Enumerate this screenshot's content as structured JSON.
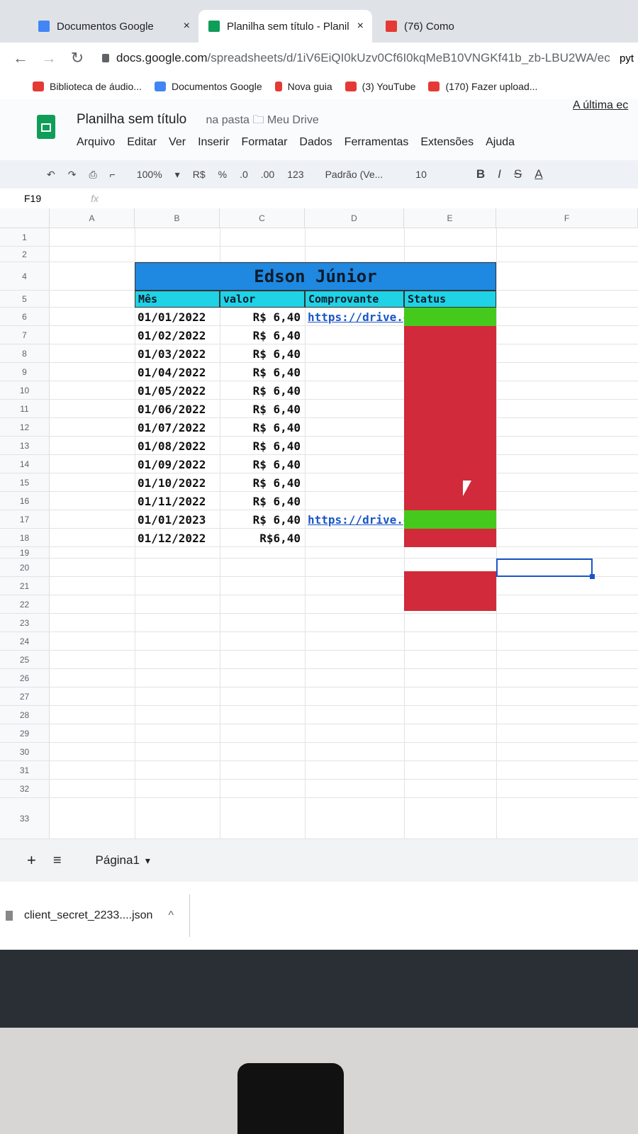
{
  "tabs": [
    {
      "title": "Documentos Google",
      "close": "×"
    },
    {
      "title": "Planilha sem título - Planil",
      "close": "×"
    },
    {
      "title": "(76) Como",
      "close": ""
    }
  ],
  "address": {
    "domain": "docs.google.com",
    "path": "/spreadsheets/d/1iV6EiQI0kUzv0Cf6I0kqMeB10VNGKf41b_zb-LBU2WA/ec",
    "extra": "pyt"
  },
  "bookmarks": [
    {
      "label": "Biblioteca de áudio...",
      "color": "#e53935"
    },
    {
      "label": "Documentos Google",
      "color": "#4285f4"
    },
    {
      "label": "Nova guia",
      "color": "#e53935"
    },
    {
      "label": "(3) YouTube",
      "color": "#e53935"
    },
    {
      "label": "(170) Fazer upload...",
      "color": "#e53935"
    }
  ],
  "sheet": {
    "title": "Planilha sem título",
    "folder_prefix": "na pasta",
    "folder": "Meu Drive",
    "last_edit": "A última ec",
    "menu": [
      "Arquivo",
      "Editar",
      "Ver",
      "Inserir",
      "Formatar",
      "Dados",
      "Ferramentas",
      "Extensões",
      "Ajuda"
    ]
  },
  "toolbar": {
    "zoom": "100%",
    "currency": "R$",
    "percent": "%",
    "dec_less": ".0",
    "dec_more": ".00",
    "format": "123",
    "font": "Padrão (Ve...",
    "font_size": "10",
    "bold": "B",
    "italic": "I",
    "strike": "S",
    "color": "A"
  },
  "formula": {
    "cell_ref": "F19",
    "fx": "fx"
  },
  "columns": [
    "A",
    "B",
    "C",
    "D",
    "E",
    "F"
  ],
  "rows": [
    "1",
    "2",
    "4",
    "5",
    "6",
    "7",
    "8",
    "9",
    "10",
    "11",
    "12",
    "13",
    "14",
    "15",
    "16",
    "17",
    "18",
    "19",
    "20",
    "21",
    "22",
    "23",
    "24",
    "25",
    "26",
    "27",
    "28",
    "29",
    "30",
    "31",
    "32",
    "33"
  ],
  "table": {
    "title": "Edson Júnior",
    "headers": {
      "month": "Mês",
      "value": "valor",
      "receipt": "Comprovante",
      "status": "Status"
    },
    "records": [
      {
        "month": "01/01/2022",
        "value": "R$ 6,40",
        "receipt": "https://drive.g",
        "status": "green"
      },
      {
        "month": "01/02/2022",
        "value": "R$ 6,40",
        "receipt": "",
        "status": "red"
      },
      {
        "month": "01/03/2022",
        "value": "R$ 6,40",
        "receipt": "",
        "status": "red"
      },
      {
        "month": "01/04/2022",
        "value": "R$ 6,40",
        "receipt": "",
        "status": "red"
      },
      {
        "month": "01/05/2022",
        "value": "R$ 6,40",
        "receipt": "",
        "status": "red"
      },
      {
        "month": "01/06/2022",
        "value": "R$ 6,40",
        "receipt": "",
        "status": "red"
      },
      {
        "month": "01/07/2022",
        "value": "R$ 6,40",
        "receipt": "",
        "status": "red"
      },
      {
        "month": "01/08/2022",
        "value": "R$ 6,40",
        "receipt": "",
        "status": "red"
      },
      {
        "month": "01/09/2022",
        "value": "R$ 6,40",
        "receipt": "",
        "status": "red"
      },
      {
        "month": "01/10/2022",
        "value": "R$ 6,40",
        "receipt": "",
        "status": "red"
      },
      {
        "month": "01/11/2022",
        "value": "R$ 6,40",
        "receipt": "",
        "status": "red"
      },
      {
        "month": "01/01/2023",
        "value": "R$ 6,40",
        "receipt": "https://drive.goo",
        "status": "green"
      },
      {
        "month": "01/12/2022",
        "value": "R$6,40",
        "receipt": "",
        "status": "red"
      }
    ]
  },
  "sheet_tabs": {
    "add": "+",
    "list": "≡",
    "active": "Página1"
  },
  "download": {
    "file": "client_secret_2233....json",
    "chevron": "^"
  },
  "colors": {
    "green": "#45c91c",
    "red": "#d12a3a",
    "title_bg": "#1f88e0",
    "header_bg": "#1fd2e6",
    "link": "#1a56c9"
  }
}
